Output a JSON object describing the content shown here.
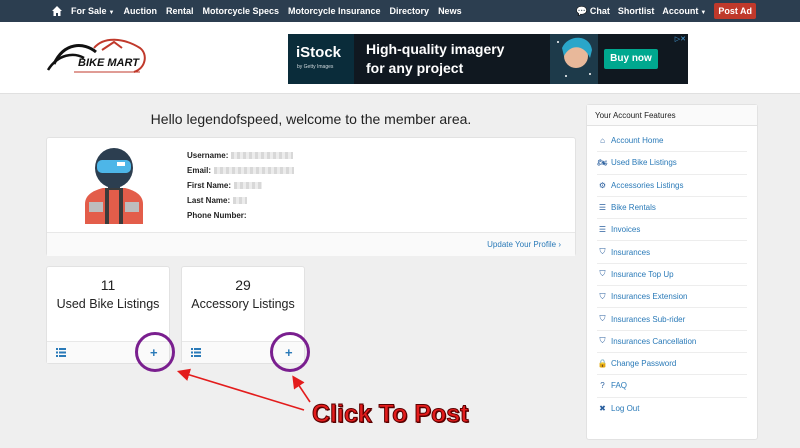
{
  "nav": {
    "left": [
      "For Sale",
      "Auction",
      "Rental",
      "Motorcycle Specs",
      "Motorcycle Insurance",
      "Directory",
      "News"
    ],
    "chat": "Chat",
    "shortlist": "Shortlist",
    "account": "Account",
    "post_ad": "Post Ad"
  },
  "logo": {
    "text": "BIKE MART"
  },
  "ad": {
    "brand": "iStock",
    "brand_sub": "by Getty Images",
    "line1": "High-quality imagery",
    "line2": "for any project",
    "button": "Buy now"
  },
  "welcome": "Hello legendofspeed, welcome to the member area.",
  "profile": {
    "username_label": "Username:",
    "email_label": "Email:",
    "first_name_label": "First Name:",
    "last_name_label": "Last Name:",
    "phone_label": "Phone Number:",
    "update_link": "Update Your Profile"
  },
  "stats": [
    {
      "count": "11",
      "label": "Used Bike Listings",
      "plus": "+"
    },
    {
      "count": "29",
      "label": "Accessory Listings",
      "plus": "+"
    }
  ],
  "annotation": {
    "text": "Click To Post"
  },
  "sidebar": {
    "title": "Your Account Features",
    "items": [
      {
        "label": "Account Home",
        "icon": "home-icon"
      },
      {
        "label": "Used Bike Listings",
        "icon": "motorcycle-icon"
      },
      {
        "label": "Accessories Listings",
        "icon": "cogs-icon"
      },
      {
        "label": "Bike Rentals",
        "icon": "list-icon"
      },
      {
        "label": "Invoices",
        "icon": "list-icon"
      },
      {
        "label": "Insurances",
        "icon": "shield-icon"
      },
      {
        "label": "Insurance Top Up",
        "icon": "shield-icon"
      },
      {
        "label": "Insurances Extension",
        "icon": "shield-icon"
      },
      {
        "label": "Insurances Sub-rider",
        "icon": "shield-icon"
      },
      {
        "label": "Insurances Cancellation",
        "icon": "shield-icon"
      },
      {
        "label": "Change Password",
        "icon": "lock-icon"
      },
      {
        "label": "FAQ",
        "icon": "question-icon"
      },
      {
        "label": "Log Out",
        "icon": "logout-icon"
      }
    ]
  },
  "colors": {
    "nav_bg": "#2c3e50",
    "link": "#2a7ab8",
    "post_ad": "#c0392b",
    "annotation": "#e31c1c",
    "circle": "#7a1f8f"
  }
}
